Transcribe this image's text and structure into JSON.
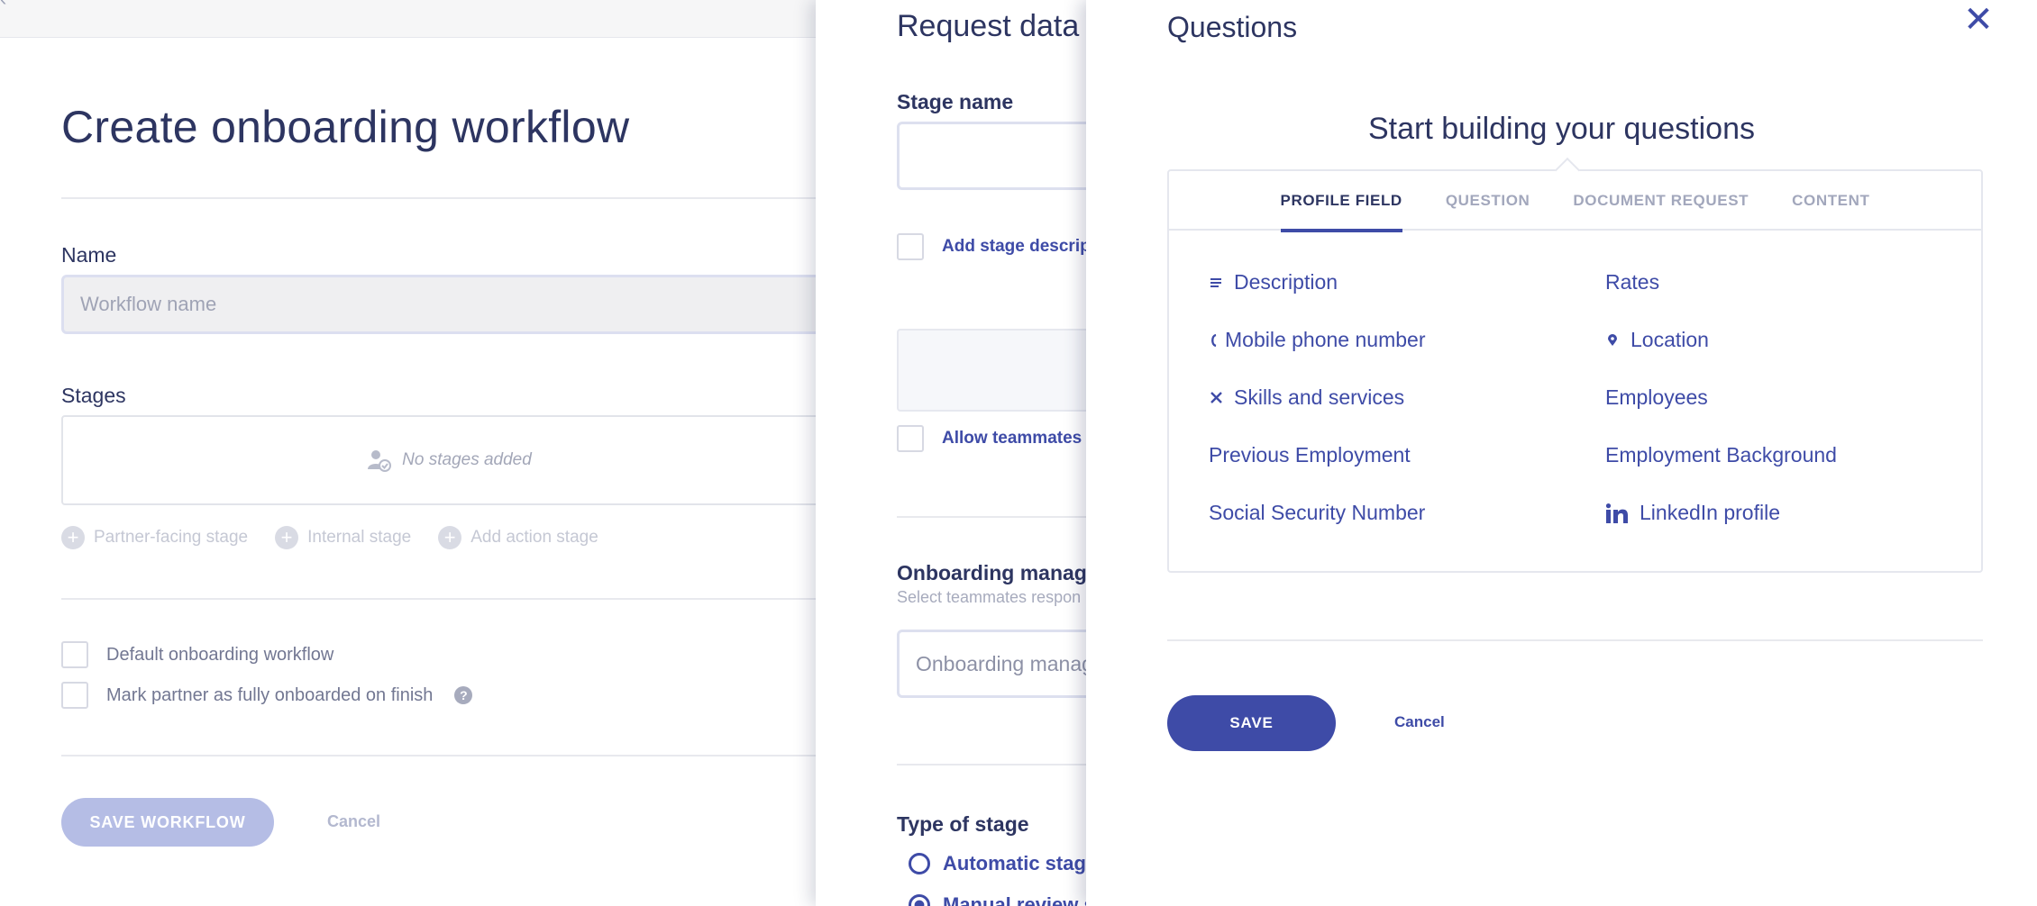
{
  "base": {
    "title": "Create onboarding workflow",
    "name_label": "Name",
    "name_placeholder": "Workflow name",
    "stages_label": "Stages",
    "no_stages": "No stages added",
    "stage_actions": [
      "Partner-facing stage",
      "Internal stage",
      "Add action stage"
    ],
    "default_workflow": "Default onboarding workflow",
    "mark_onboarded": "Mark partner as fully onboarded on finish",
    "help_glyph": "?",
    "save_label": "SAVE WORKFLOW",
    "cancel_label": "Cancel"
  },
  "middle": {
    "title": "Request data st",
    "stage_name_label": "Stage name",
    "add_description": "Add stage descript",
    "allow_teammates": "Allow teammates t",
    "onboarding_manager_label": "Onboarding manage",
    "onboarding_manager_sub": "Select teammates respon",
    "onboarding_manager_placeholder": "Onboarding manag",
    "type_label": "Type of stage",
    "radio_automatic": "Automatic stage",
    "radio_manual": "Manual review s"
  },
  "questions": {
    "title": "Questions",
    "close_glyph": "✕",
    "heading": "Start building your questions",
    "tabs": [
      "PROFILE FIELD",
      "QUESTION",
      "DOCUMENT REQUEST",
      "CONTENT"
    ],
    "fields_left": [
      "Description",
      "Mobile phone number",
      "Skills and services",
      "Previous Employment",
      "Social Security Number"
    ],
    "fields_right": [
      "Rates",
      "Location",
      "Employees",
      "Employment Background",
      "LinkedIn profile"
    ],
    "save_label": "SAVE",
    "cancel_label": "Cancel"
  },
  "colors": {
    "accent": "#3e4ba7",
    "text_dark": "#2d3561",
    "muted": "#a2a7bc"
  }
}
